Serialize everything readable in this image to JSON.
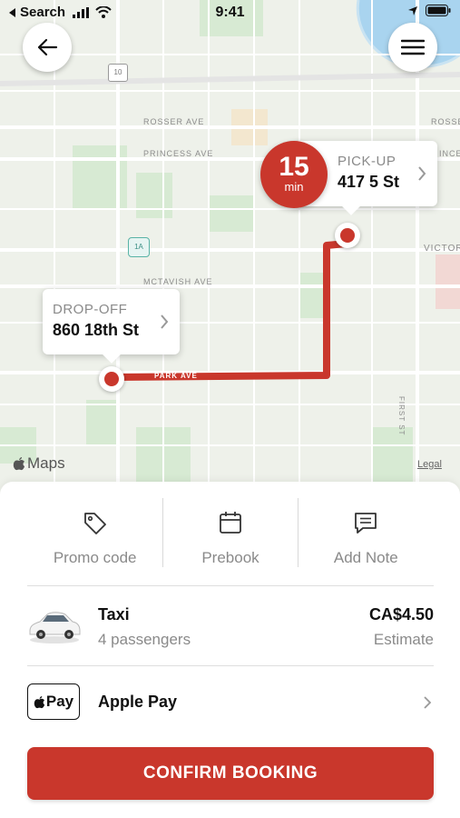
{
  "status_bar": {
    "back_app": "Search",
    "time": "9:41"
  },
  "map": {
    "streets": {
      "rosser": "ROSSER AVE",
      "rosser_right": "ROSSE",
      "princess": "PRINCESS AVE",
      "princess_right": "INCE",
      "mctavish": "MCTAVISH AVE",
      "victoria": "VICTOR",
      "park": "PARK AVE",
      "first": "FIRST ST",
      "shield_10": "10",
      "shield_1a": "1A"
    },
    "eta": {
      "value": "15",
      "unit": "min"
    },
    "pickup": {
      "label": "PICK-UP",
      "address": "417 5 St"
    },
    "dropoff": {
      "label": "DROP-OFF",
      "address": "860 18th St"
    },
    "maps_brand": "Maps",
    "legal": "Legal",
    "route_color": "#c9372c"
  },
  "actions": [
    {
      "label": "Promo code",
      "icon": "tag-icon"
    },
    {
      "label": "Prebook",
      "icon": "calendar-icon"
    },
    {
      "label": "Add Note",
      "icon": "note-icon"
    }
  ],
  "ride": {
    "name": "Taxi",
    "capacity": "4 passengers",
    "price": "CA$4.50",
    "price_note": "Estimate"
  },
  "payment": {
    "badge": "Pay",
    "label": "Apple Pay"
  },
  "confirm_label": "CONFIRM BOOKING",
  "accent_color": "#c9372c"
}
